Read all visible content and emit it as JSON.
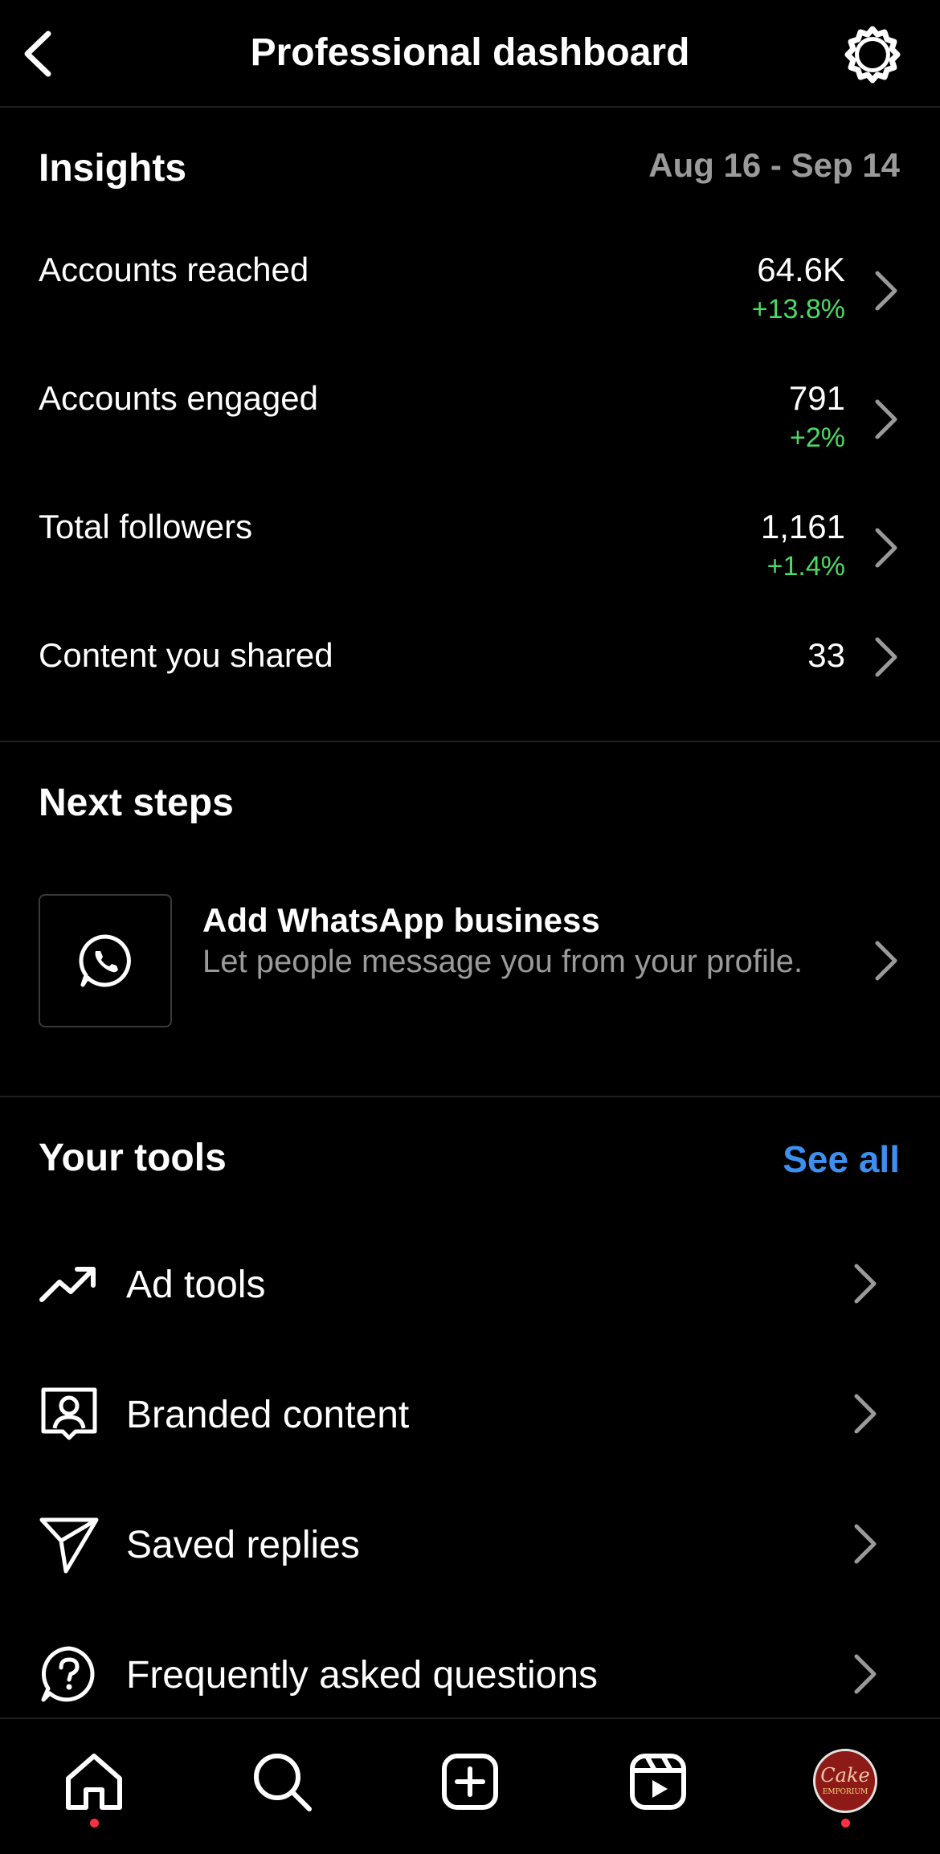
{
  "header": {
    "title": "Professional dashboard",
    "back_icon": "chevron-left-icon",
    "settings_icon": "gear-icon"
  },
  "insights": {
    "title": "Insights",
    "date_range": "Aug 16 - Sep 14",
    "metrics": [
      {
        "label": "Accounts reached",
        "value": "64.6K",
        "change": "+13.8%"
      },
      {
        "label": "Accounts engaged",
        "value": "791",
        "change": "+2%"
      },
      {
        "label": "Total followers",
        "value": "1,161",
        "change": "+1.4%"
      },
      {
        "label": "Content you shared",
        "value": "33",
        "change": ""
      }
    ],
    "change_color": "#4cd964"
  },
  "next_steps": {
    "title": "Next steps",
    "item": {
      "icon": "whatsapp-icon",
      "title": "Add WhatsApp business",
      "description": "Let people message you from your profile."
    }
  },
  "tools": {
    "title": "Your tools",
    "see_all": "See all",
    "link_color": "#3d8ff0",
    "items": [
      {
        "icon": "trending-up-icon",
        "label": "Ad tools"
      },
      {
        "icon": "branded-content-icon",
        "label": "Branded content"
      },
      {
        "icon": "paper-plane-icon",
        "label": "Saved replies"
      },
      {
        "icon": "question-bubble-icon",
        "label": "Frequently asked questions"
      }
    ]
  },
  "bottom_nav": {
    "items": [
      "home-icon",
      "search-icon",
      "create-icon",
      "reels-icon",
      "profile-avatar"
    ],
    "notification_color": "#ff3040",
    "avatar_text": "Cake",
    "avatar_subtext": "EMPORIUM"
  }
}
